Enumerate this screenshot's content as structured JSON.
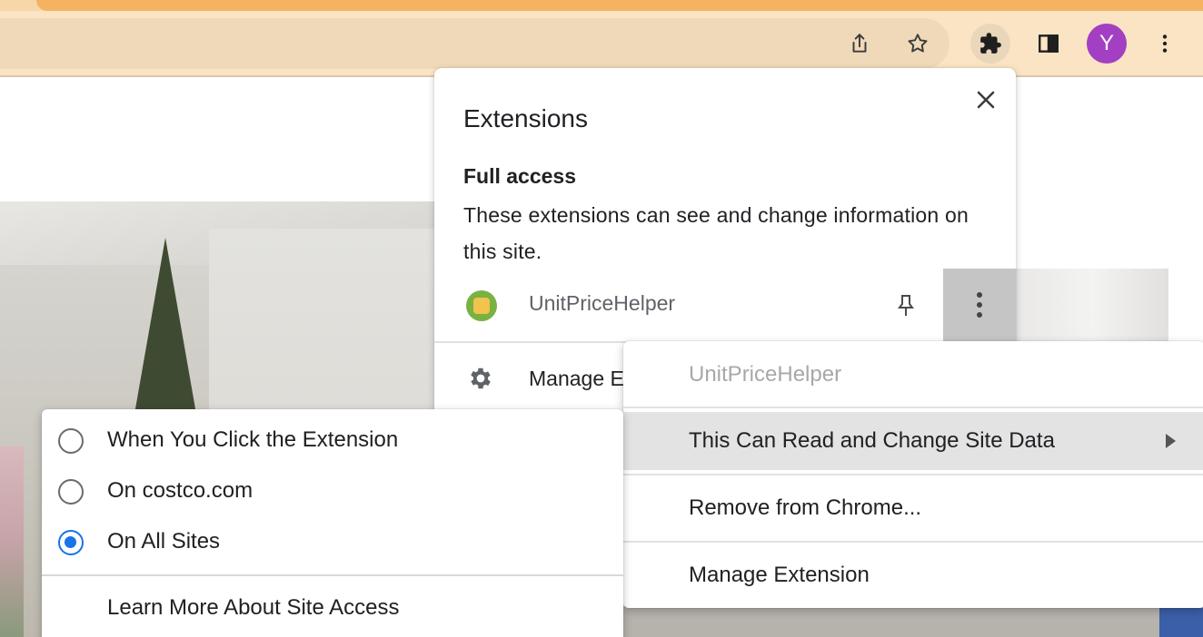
{
  "browser": {
    "toolbar_icons": [
      "share-icon",
      "bookmark-star-icon",
      "extensions-puzzle-icon",
      "side-panel-icon",
      "more-vert-icon"
    ],
    "profile_initial": "Y",
    "profile_color": "#a33fc3"
  },
  "extensions_popup": {
    "title": "Extensions",
    "section_title": "Full access",
    "section_description": "These extensions can see and change information on this site.",
    "extension": {
      "name": "UnitPriceHelper",
      "icon": "unitpricehelper-icon"
    },
    "manage_label": "Manage E"
  },
  "context_menu": {
    "header": "UnitPriceHelper",
    "items": [
      {
        "label": "This Can Read and Change Site Data",
        "has_submenu": true,
        "highlighted": true
      },
      {
        "label": "Remove from Chrome..."
      },
      {
        "label": "Manage Extension"
      }
    ]
  },
  "site_access_menu": {
    "options": [
      {
        "label": "When You Click the Extension",
        "checked": false
      },
      {
        "label": "On costco.com",
        "checked": false
      },
      {
        "label": "On All Sites",
        "checked": true
      }
    ],
    "learn_more": "Learn More About Site Access"
  },
  "colors": {
    "accent": "#1a73e8",
    "toolbar": "#fbe4c3",
    "highlight": "#e3e3e3"
  }
}
